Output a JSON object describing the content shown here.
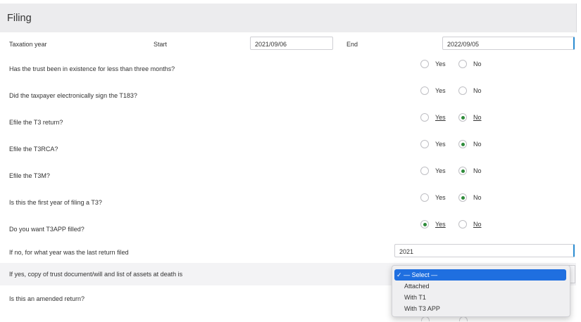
{
  "section": {
    "title": "Filing"
  },
  "taxation_year": {
    "label": "Taxation year",
    "start_label": "Start",
    "start_value": "2021/09/06",
    "end_label": "End",
    "end_value": "2022/09/05"
  },
  "questions": [
    {
      "text": "Has the trust been in existence for less than three months?",
      "yes": "Yes",
      "no": "No",
      "selected": "none"
    },
    {
      "text": "Did the taxpayer electronically sign the T183?",
      "yes": "Yes",
      "no": "No",
      "selected": "none"
    },
    {
      "text": "Efile the T3 return?",
      "yes": "Yes",
      "no": "No",
      "selected": "no"
    },
    {
      "text": "Efile the T3RCA?",
      "yes": "Yes",
      "no": "No",
      "selected": "no"
    },
    {
      "text": "Efile the T3M?",
      "yes": "Yes",
      "no": "No",
      "selected": "no"
    },
    {
      "text": "Is this the first year of filing a T3?",
      "yes": "Yes",
      "no": "No",
      "selected": "no"
    },
    {
      "text": "Do you want T3APP filled?",
      "yes": "Yes",
      "no": "No",
      "selected": "yes"
    }
  ],
  "last_return": {
    "text": "If no, for what year was the last return filed",
    "value": "2021"
  },
  "trust_document": {
    "text": "If yes, copy of trust document/will and list of assets at death is",
    "options": [
      "— Select —",
      "Attached",
      "With T1",
      "With T3 APP"
    ],
    "selected": "— Select —",
    "check_mark": "✓"
  },
  "amended": {
    "text": "Is this an amended return?"
  },
  "colors": {
    "accent": "#2a8bd0",
    "radio_checked": "#2e8b3a",
    "menu_highlight": "#1f6fe0"
  }
}
